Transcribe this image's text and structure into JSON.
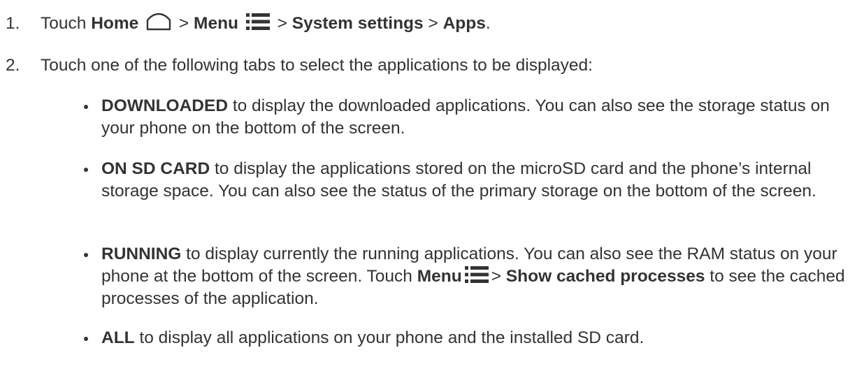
{
  "step1": {
    "number": "1.",
    "touch": "Touch",
    "home": "Home",
    "sep1": ">",
    "menu": "Menu",
    "sep2": ">",
    "system_settings": "System settings",
    "sep3": ">",
    "apps": "Apps",
    "period": "."
  },
  "step2": {
    "number": "2.",
    "text": "Touch one of the following tabs to select the applications to be displayed:"
  },
  "bullets": [
    {
      "label": "DOWNLOADED",
      "text": " to display the downloaded applications. You can also see the storage status on your phone on the bottom of the screen."
    },
    {
      "label": "ON SD CARD",
      "text": " to display the applications stored on the microSD card and the phone’s internal storage space. You can also see the status of the primary storage on the bottom of the screen."
    },
    {
      "label": "RUNNING",
      "text": " to display currently the running applications. You can also see the RAM status on your phone at the bottom of the screen. Touch ",
      "menu": "Menu",
      "sep": ">",
      "show_cached": "Show cached processes",
      "text_after": " to see the cached processes of the application."
    },
    {
      "label": "ALL",
      "text": " to display all applications on your phone and the installed SD card."
    }
  ],
  "icons": {
    "home": "home-icon",
    "menu": "menu-icon"
  }
}
